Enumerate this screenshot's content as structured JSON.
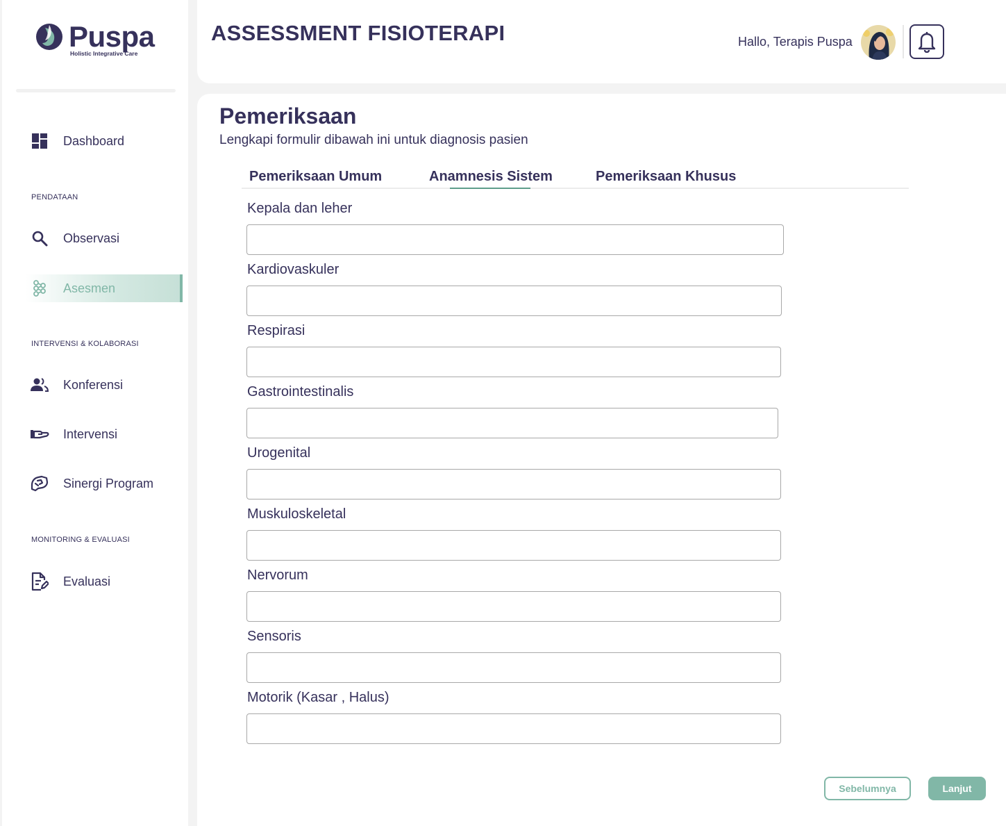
{
  "brand": {
    "name": "Puspa",
    "tagline": "Holistic Integrative Care",
    "primary_color": "#36315b",
    "accent_color": "#81b7a7"
  },
  "sidebar": {
    "dashboard": {
      "label": "Dashboard",
      "icon": "dashboard-icon"
    },
    "sections": [
      {
        "title": "PENDATAAN",
        "items": [
          {
            "label": "Observasi",
            "icon": "search-icon"
          },
          {
            "label": "Asesmen",
            "icon": "asesmen-icon",
            "active": true
          }
        ]
      },
      {
        "title": "INTERVENSI & KOLABORASI",
        "items": [
          {
            "label": "Konferensi",
            "icon": "people-icon"
          },
          {
            "label": "Intervensi",
            "icon": "hand-icon"
          },
          {
            "label": "Sinergi Program",
            "icon": "handshake-icon"
          }
        ]
      },
      {
        "title": "MONITORING & EVALUASI",
        "items": [
          {
            "label": "Evaluasi",
            "icon": "document-edit-icon"
          }
        ]
      }
    ]
  },
  "header": {
    "title": "ASSESSMENT FISIOTERAPI",
    "greeting": "Hallo, Terapis Puspa"
  },
  "main": {
    "title": "Pemeriksaan",
    "subtitle": "Lengkapi formulir dibawah ini untuk diagnosis pasien",
    "tabs": [
      {
        "label": "Pemeriksaan Umum"
      },
      {
        "label": "Anamnesis Sistem",
        "active": true
      },
      {
        "label": "Pemeriksaan Khusus"
      }
    ],
    "fields": [
      {
        "label": "Kepala dan leher",
        "value": ""
      },
      {
        "label": "Kardiovaskuler",
        "value": ""
      },
      {
        "label": "Respirasi",
        "value": ""
      },
      {
        "label": "Gastrointestinalis",
        "value": ""
      },
      {
        "label": "Urogenital",
        "value": ""
      },
      {
        "label": "Muskuloskeletal",
        "value": ""
      },
      {
        "label": "Nervorum",
        "value": ""
      },
      {
        "label": "Sensoris",
        "value": ""
      },
      {
        "label": "Motorik (Kasar , Halus)",
        "value": ""
      }
    ],
    "buttons": {
      "prev": "Sebelumnya",
      "next": "Lanjut"
    }
  }
}
